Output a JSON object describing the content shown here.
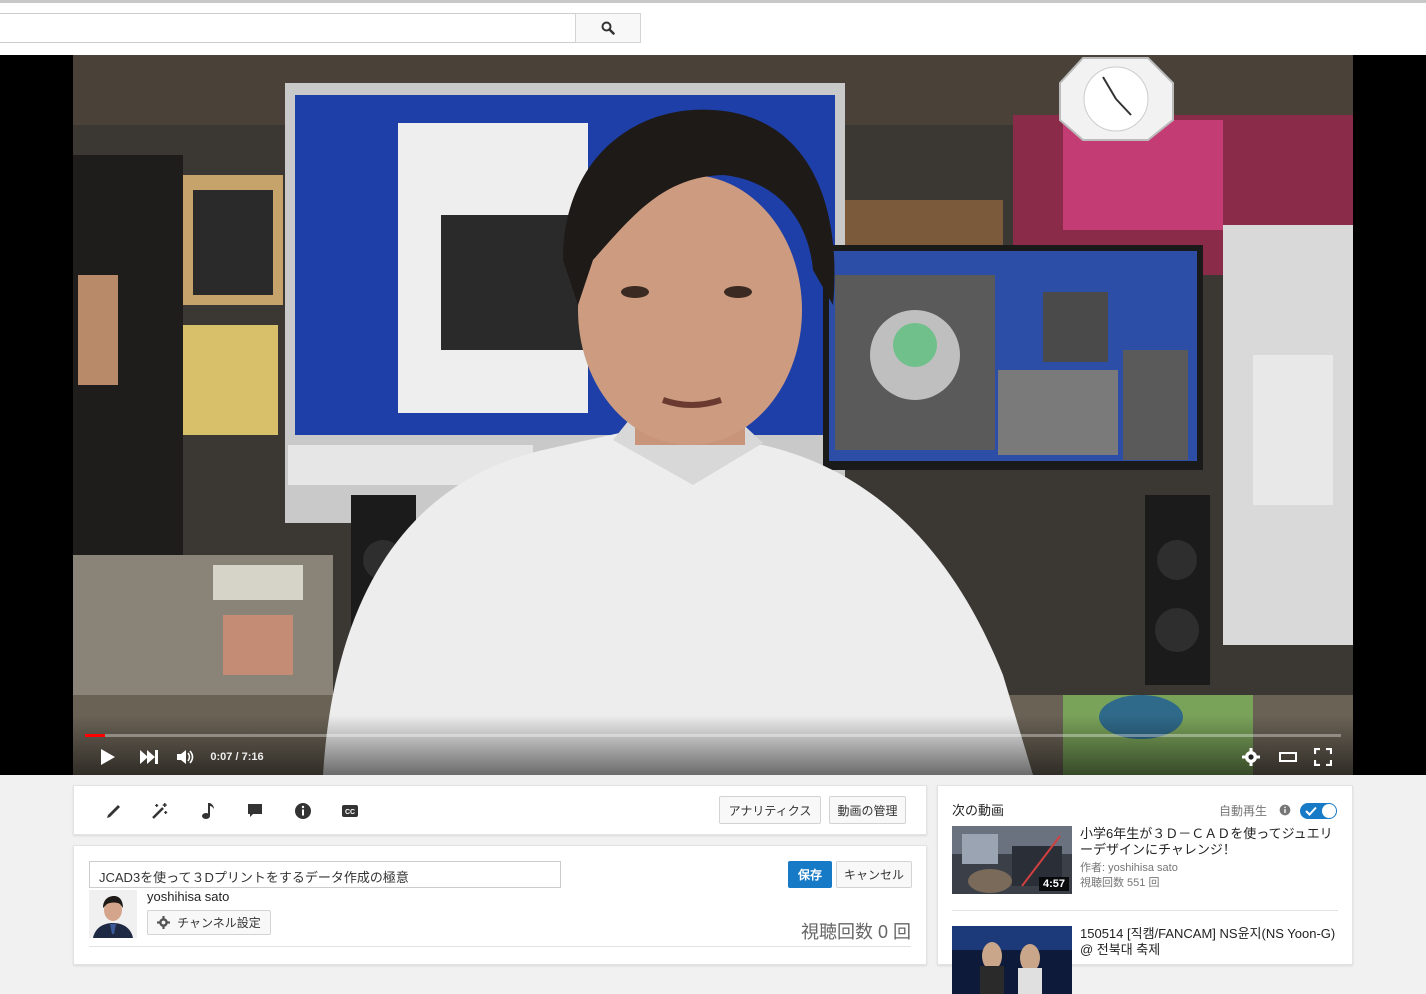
{
  "search": {
    "value": "",
    "placeholder": ""
  },
  "player": {
    "time": "0:07 / 7:16",
    "progress_fraction": 0.016
  },
  "editor": {
    "analytics_label": "アナリティクス",
    "manage_label": "動画の管理",
    "title_value": "JCAD3を使って３Dプリントをするデータ作成の極意",
    "save_label": "保存",
    "cancel_label": "キャンセル",
    "channel_name": "yoshihisa sato",
    "channel_settings_label": "チャンネル設定",
    "views_label": "視聴回数 0 回"
  },
  "sidebar": {
    "next_label": "次の動画",
    "autoplay_label": "自動再生",
    "videos": [
      {
        "title": "小学6年生が３Ｄ－ＣＡＤを使ってジュエリーデザインにチャレンジ！",
        "author": "作者: yoshihisa sato",
        "views": "視聴回数 551 回",
        "duration": "4:57"
      },
      {
        "title": "150514 [직캠/FANCAM] NS윤지(NS Yoon-G) @ 전북대 축제",
        "author": "",
        "views": "",
        "duration": ""
      }
    ]
  },
  "colors": {
    "accent": "#167ac6",
    "progress": "#ff0000",
    "page_bg": "#f1f1f1"
  }
}
